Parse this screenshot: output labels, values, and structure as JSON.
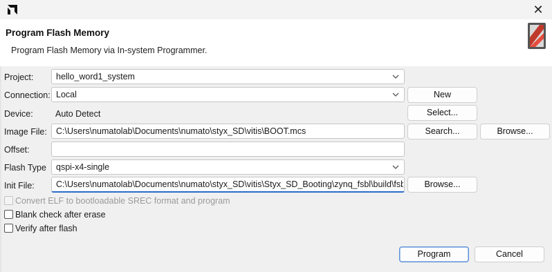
{
  "window": {
    "title_icon": "amd-logo-icon",
    "close_glyph": "✕"
  },
  "header": {
    "title": "Program Flash Memory",
    "description": "Program Flash Memory via In-system Programmer.",
    "icon": "flash-memory-icon"
  },
  "form": {
    "project": {
      "label": "Project:",
      "value": "hello_word1_system"
    },
    "connection": {
      "label": "Connection:",
      "value": "Local",
      "button": "New"
    },
    "device": {
      "label": "Device:",
      "value": "Auto Detect",
      "button": "Select..."
    },
    "image_file": {
      "label": "Image File:",
      "value": "C:\\Users\\numatolab\\Documents\\numato\\styx_SD\\vitis\\BOOT.mcs",
      "search_button": "Search...",
      "browse_button": "Browse..."
    },
    "offset": {
      "label": "Offset:",
      "value": ""
    },
    "flash_type": {
      "label": "Flash Type",
      "value": "qspi-x4-single"
    },
    "init_file": {
      "label": "Init File:",
      "value": "C:\\Users\\numatolab\\Documents\\numato\\styx_SD\\vitis\\Styx_SD_Booting\\zynq_fsbl\\build\\fsbl.elf",
      "browse_button": "Browse..."
    }
  },
  "options": {
    "convert_elf": {
      "label": "Convert ELF to bootloadable SREC format and program",
      "checked": false,
      "enabled": false
    },
    "blank_check": {
      "label": "Blank check after erase",
      "checked": false,
      "enabled": true
    },
    "verify": {
      "label": "Verify after flash",
      "checked": false,
      "enabled": true
    }
  },
  "footer": {
    "program_button": "Program",
    "cancel_button": "Cancel"
  }
}
